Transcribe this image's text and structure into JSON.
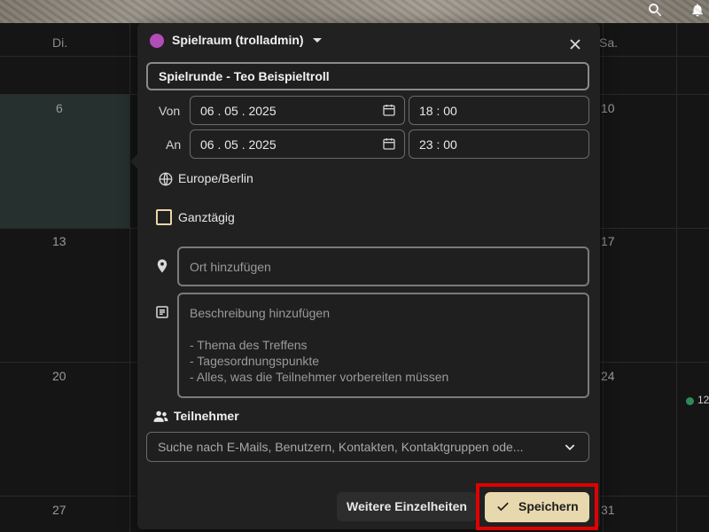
{
  "calendar": {
    "headers": [
      {
        "key": "di",
        "label": "Di."
      },
      {
        "key": "sa",
        "label": "Sa."
      }
    ],
    "day_numbers": {
      "d6": "6",
      "d10": "10",
      "d13": "13",
      "d17": "17",
      "d20": "20",
      "d24": "24",
      "d27": "27",
      "d31": "31"
    },
    "event_preview_time": "12"
  },
  "dialog": {
    "calendar_name": "Spielraum (trolladmin)",
    "calendar_color": "#b24db8",
    "title_value": "Spielrunde - Teo Beispieltroll",
    "from_label": "Von",
    "to_label": "An",
    "start_date": "06 . 05 . 2025",
    "start_time": "18 : 00",
    "end_date": "06 . 05 . 2025",
    "end_time": "23 : 00",
    "timezone": "Europe/Berlin",
    "all_day_label": "Ganztägig",
    "all_day_checked": false,
    "location_placeholder": "Ort hinzufügen",
    "description_placeholder_lines": [
      "Beschreibung hinzufügen",
      "",
      "- Thema des Treffens",
      "- Tagesordnungspunkte",
      "- Alles, was die Teilnehmer vorbereiten müssen"
    ],
    "attendees_label": "Teilnehmer",
    "attendees_search_placeholder": "Suche nach E-Mails, Benutzern, Kontakten, Kontaktgruppen ode...",
    "more_details_button": "Weitere Einzelheiten",
    "save_button": "Speichern"
  },
  "colors": {
    "accent_button": "#e8d8ad",
    "highlight_outline": "#e00000",
    "selected_day_bg": "#26302f",
    "event_dot": "#2e8b57"
  },
  "icons": [
    "search-icon",
    "bell-icon",
    "close-icon",
    "calendar-picker-icon",
    "globe-icon",
    "location-pin-icon",
    "description-icon",
    "people-icon",
    "chevron-down-icon",
    "check-icon"
  ]
}
